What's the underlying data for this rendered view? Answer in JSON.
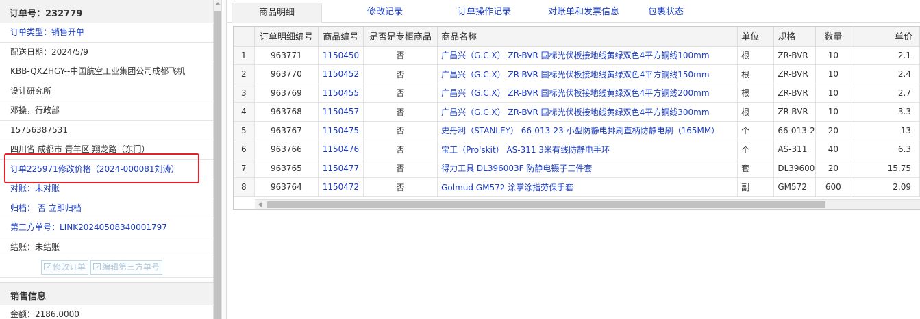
{
  "order": {
    "header_label": "订单号：",
    "header_value": "232779",
    "type_label": "订单类型：",
    "type_value": "销售开单",
    "date": "配送日期：2024/5/9",
    "customer_line1": "KBB-QXZHGY--中国航空工业集团公司成都飞机",
    "customer_line2": "设计研究所",
    "contact": "邓操，行政部",
    "phone": "15756387531",
    "address": "四川省 成都市 青羊区 翔龙路（东门）",
    "modify_note": "订单225971修改价格（2024-000081刘涛）",
    "recon_label": "对账：",
    "recon_value": "未对账",
    "archive_label": "归档：",
    "archive_value": "否",
    "archive_action": "立即归档",
    "third_party_label": "第三方单号：",
    "third_party_value": "LINK20240508340001797",
    "settle": "结账：未结账",
    "btn_modify": "修改订单",
    "btn_edit_third": "编辑第三方单号"
  },
  "sales": {
    "title": "销售信息",
    "amount": "金额：2186.0000"
  },
  "tabs": [
    {
      "label": "商品明细",
      "active": true
    },
    {
      "label": "修改记录"
    },
    {
      "label": "订单操作记录"
    },
    {
      "label": "对账单和发票信息"
    },
    {
      "label": "包裹状态"
    }
  ],
  "table": {
    "headers": [
      "",
      "订单明细编号",
      "商品编号",
      "是否是专柜商品",
      "商品名称",
      "单位",
      "规格",
      "数量",
      "单价"
    ],
    "rows": [
      [
        "1",
        "963771",
        "1150450",
        "否",
        "广昌兴（G.C.X） ZR-BVR 国标光伏板接地线黄绿双色4平方铜线100mm",
        "根",
        "ZR-BVR",
        "10",
        "2.1"
      ],
      [
        "2",
        "963770",
        "1150452",
        "否",
        "广昌兴（G.C.X） ZR-BVR 国标光伏板接地线黄绿双色4平方铜线150mm",
        "根",
        "ZR-BVR",
        "10",
        "2.4"
      ],
      [
        "3",
        "963769",
        "1150455",
        "否",
        "广昌兴（G.C.X） ZR-BVR 国标光伏板接地线黄绿双色4平方铜线200mm",
        "根",
        "ZR-BVR",
        "10",
        "2.7"
      ],
      [
        "4",
        "963768",
        "1150457",
        "否",
        "广昌兴（G.C.X） ZR-BVR 国标光伏板接地线黄绿双色4平方铜线300mm",
        "根",
        "ZR-BVR",
        "10",
        "3.3"
      ],
      [
        "5",
        "963767",
        "1150475",
        "否",
        "史丹利（STANLEY） 66-013-23 小型防静电排刷直柄防静电刷（165MM）",
        "个",
        "66-013-2",
        "20",
        "13"
      ],
      [
        "6",
        "963766",
        "1150476",
        "否",
        "宝工（Pro'skit） AS-311 3米有线防静电手环",
        "个",
        "AS-311",
        "40",
        "6.3"
      ],
      [
        "7",
        "963765",
        "1150477",
        "否",
        "得力工具 DL396003F 防静电镊子三件套",
        "套",
        "DL39600",
        "20",
        "15.75"
      ],
      [
        "8",
        "963764",
        "1150472",
        "否",
        "Golmud GM572 涂掌涂指劳保手套",
        "副",
        "GM572",
        "600",
        "2.09"
      ]
    ]
  }
}
